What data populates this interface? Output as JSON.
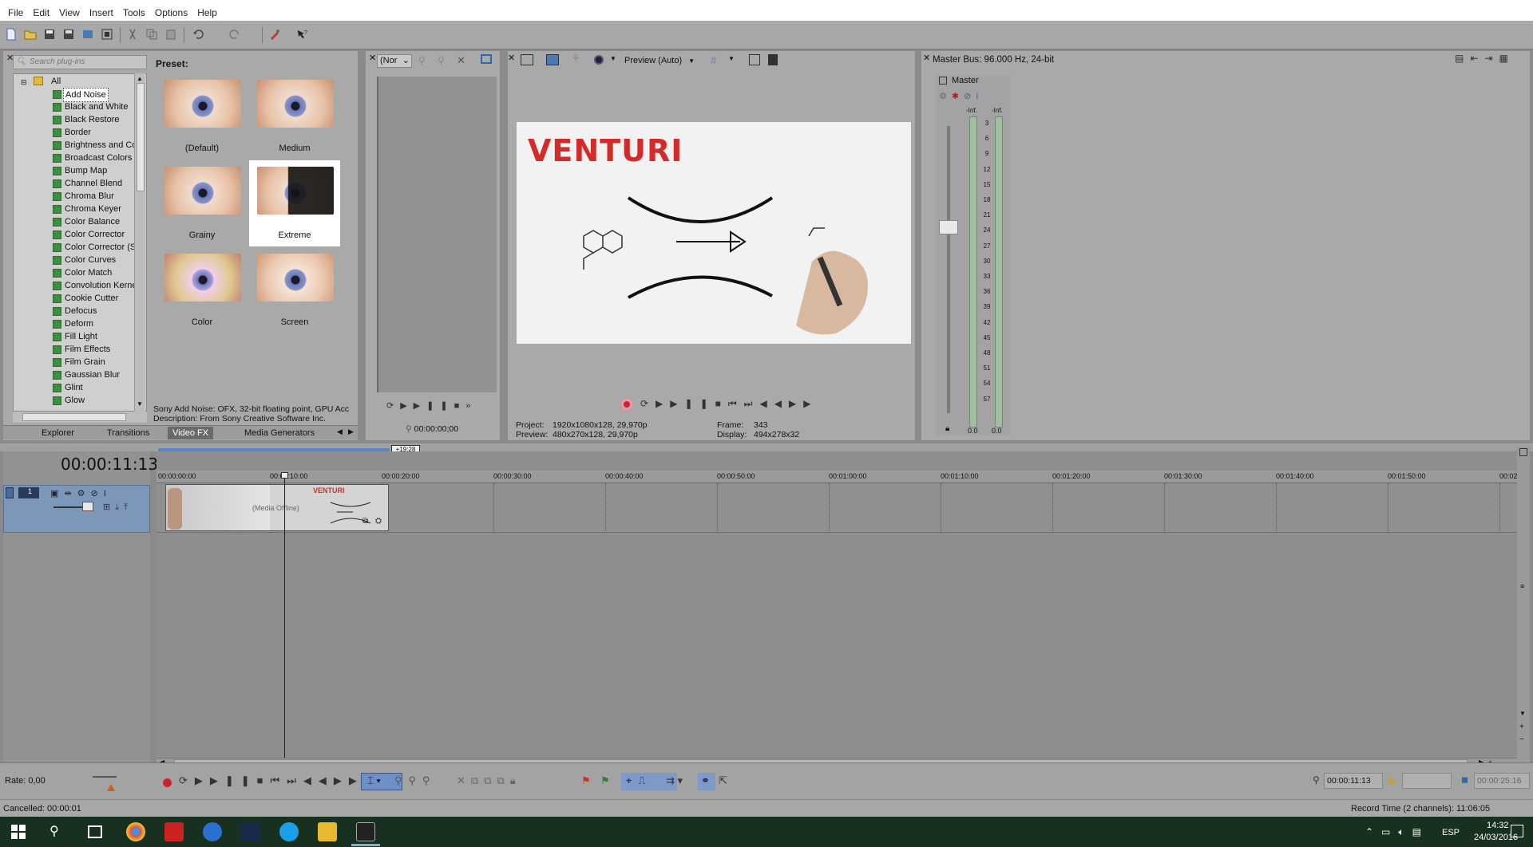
{
  "menu": [
    "File",
    "Edit",
    "View",
    "Insert",
    "Tools",
    "Options",
    "Help"
  ],
  "explorer": {
    "search_placeholder": "Search plug-ins",
    "root": "All",
    "plugins": [
      "Add Noise",
      "Black and White",
      "Black Restore",
      "Border",
      "Brightness and Co",
      "Broadcast Colors",
      "Bump Map",
      "Channel Blend",
      "Chroma Blur",
      "Chroma Keyer",
      "Color Balance",
      "Color Corrector",
      "Color Corrector (S",
      "Color Curves",
      "Color Match",
      "Convolution Kerne",
      "Cookie Cutter",
      "Defocus",
      "Deform",
      "Fill Light",
      "Film Effects",
      "Film Grain",
      "Gaussian Blur",
      "Glint",
      "Glow"
    ],
    "selected_plugin": "Add Noise",
    "preset_label": "Preset:",
    "presets": [
      "(Default)",
      "Medium",
      "Grainy",
      "Extreme",
      "Color",
      "Screen"
    ],
    "selected_preset": "Extreme",
    "description_line1": "Sony Add Noise: OFX, 32-bit floating point, GPU Acc",
    "description_line2": "Description: From Sony Creative Software Inc.",
    "tabs": [
      "Explorer",
      "Transitions",
      "Video FX",
      "Media Generators"
    ],
    "active_tab": "Video FX"
  },
  "trimmer": {
    "dropdown": "(Nor",
    "timecode": "00:00:00;00"
  },
  "preview": {
    "mode": "Preview (Auto)",
    "video_title": "VENTURI",
    "project_label": "Project:",
    "project_value": "1920x1080x128, 29,970p",
    "preview_label": "Preview:",
    "preview_value": "480x270x128, 29,970p",
    "frame_label": "Frame:",
    "frame_value": "343",
    "display_label": "Display:",
    "display_value": "494x278x32"
  },
  "master_bus": {
    "title": "Master Bus: 96.000 Hz, 24-bit",
    "channel": "Master",
    "peak_left": "-Inf.",
    "peak_right": "-Inf.",
    "scale": [
      "3",
      "6",
      "9",
      "12",
      "15",
      "18",
      "21",
      "24",
      "27",
      "30",
      "33",
      "36",
      "39",
      "42",
      "45",
      "48",
      "51",
      "54",
      "57"
    ],
    "value_left": "0.0",
    "value_right": "0.0"
  },
  "timeline": {
    "timecode": "00:00:11:13",
    "region_label": "+19:28",
    "ruler": [
      "00:00:00:00",
      "00:00:10:00",
      "00:00:20:00",
      "00:00:30:00",
      "00:00:40:00",
      "00:00:50:00",
      "00:01:00:00",
      "00:01:10:00",
      "00:01:20:00",
      "00:01:30:00",
      "00:01:40:00",
      "00:01:50:00",
      "00:02"
    ],
    "clip_offline": "(Media Offline)",
    "clip_title": "VENTURI"
  },
  "transport": {
    "rate": "Rate: 0,00",
    "cursor_time": "00:00:11:13",
    "end_time": "00:00:25:16"
  },
  "status": {
    "left": "Cancelled: 00:00:01",
    "right": "Record Time (2 channels): 11:06:05"
  },
  "taskbar": {
    "lang": "ESP",
    "time": "14:32",
    "date": "24/03/2016"
  },
  "colors": {
    "venturi_red": "#d42a2a",
    "track_blue": "#7d97b8",
    "meter_green": "#9fbf9f"
  }
}
